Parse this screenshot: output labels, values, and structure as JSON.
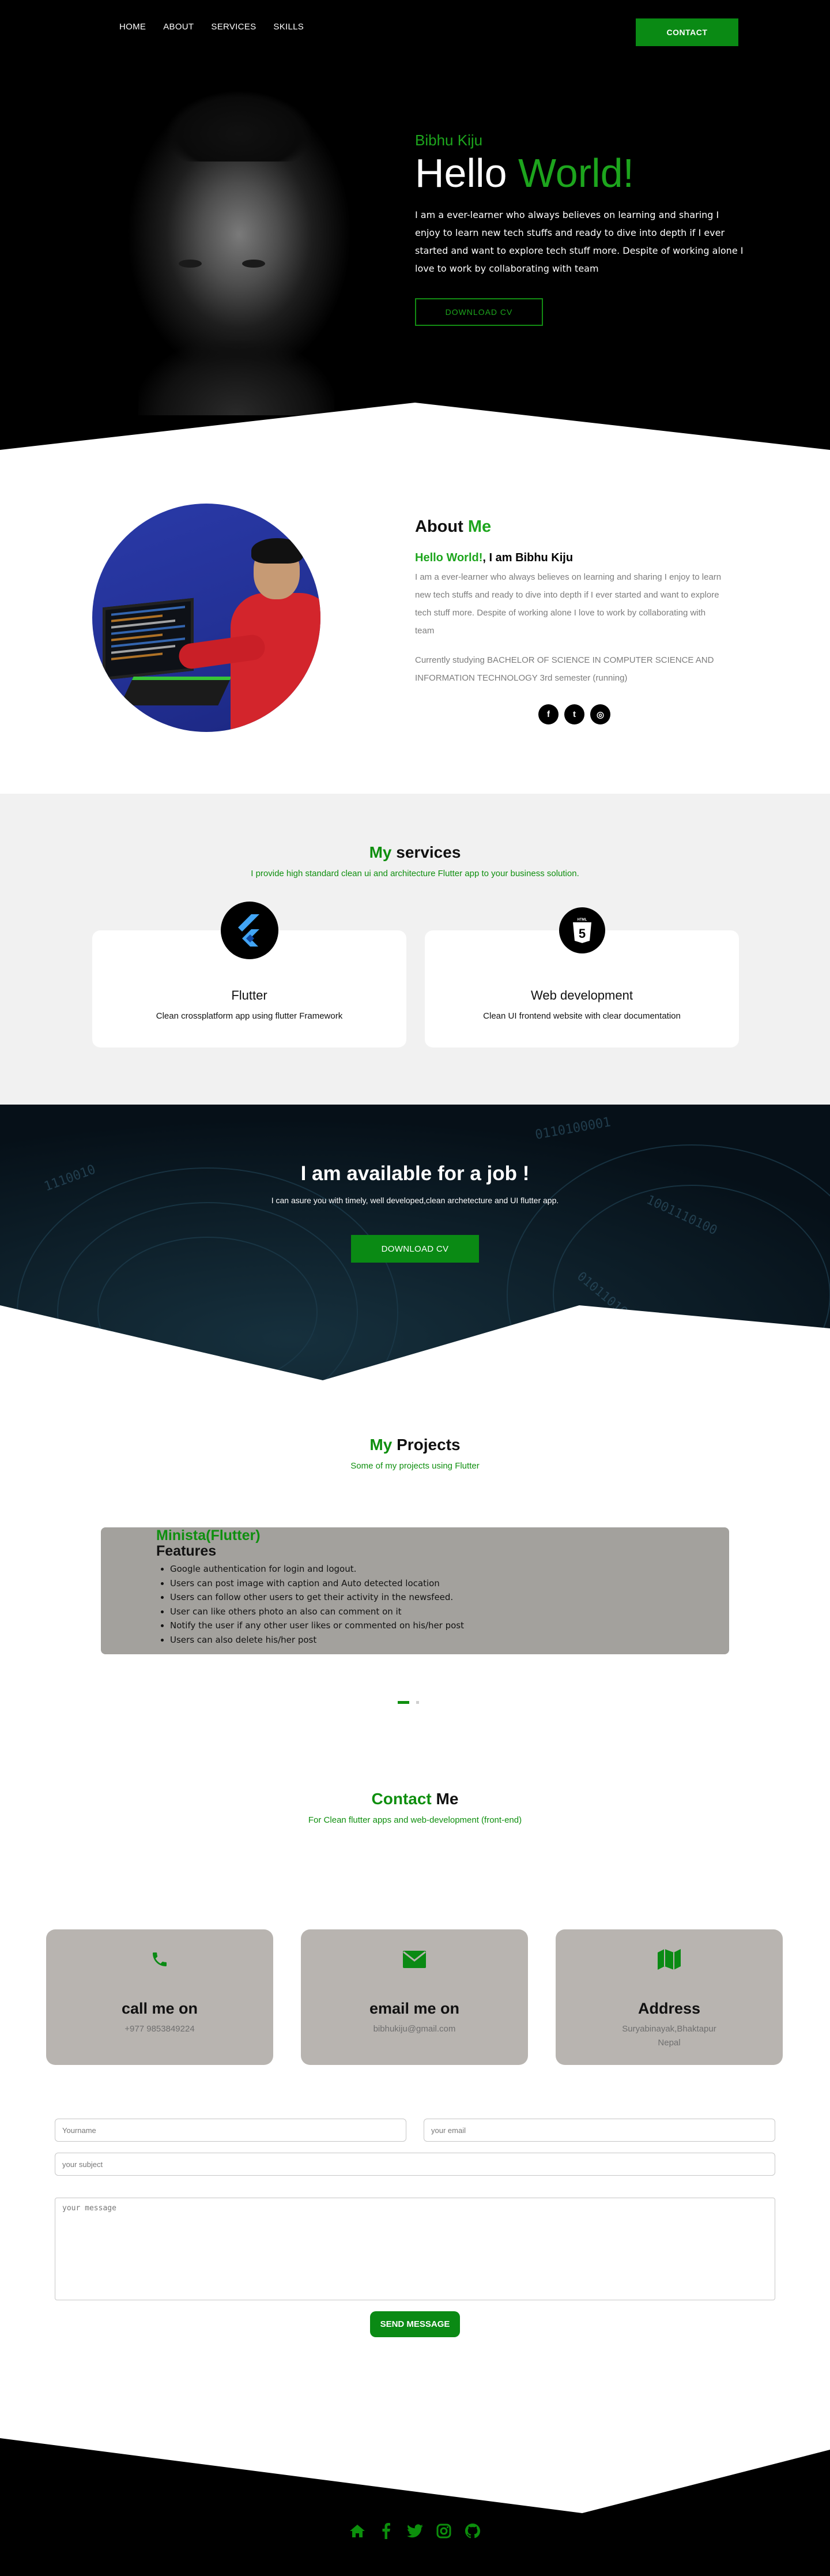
{
  "nav": {
    "items": [
      "HOME",
      "ABOUT",
      "SERVICES",
      "SKILLS"
    ],
    "contact_label": "CONTACT"
  },
  "hero": {
    "name": "Bibhu Kiju",
    "title_white": "Hello ",
    "title_green": "World!",
    "description": "I am a ever-learner who always believes on learning and sharing I enjoy to learn new tech stuffs and ready to dive into depth if I ever started and want to explore tech stuff more. Despite of working alone I love to work by collaborating with team",
    "cv_label": "DOWNLOAD CV"
  },
  "about": {
    "heading_plain": "About ",
    "heading_green": "Me",
    "hello_green": "Hello World!",
    "hello_rest": ", I am Bibhu Kiju",
    "description": "I am a ever-learner who always believes on learning and sharing I enjoy to learn new tech stuffs and ready to dive into depth if I ever started and want to explore tech stuff more. Despite of working alone I love to work by collaborating with team",
    "study": "Currently studying BACHELOR OF SCIENCE IN COMPUTER SCIENCE AND INFORMATION TECHNOLOGY 3rd semester (running)",
    "socials": [
      "f",
      "t",
      "◎"
    ]
  },
  "services": {
    "title_green": "My",
    "title_plain": " services",
    "subtitle": "I provide high standard clean ui and architecture Flutter app to your business solution.",
    "cards": [
      {
        "title": "Flutter",
        "desc": "Clean crossplatform app using flutter Framework",
        "icon": "flutter-icon"
      },
      {
        "title": "Web development",
        "desc": "Clean UI frontend website with clear documentation",
        "icon": "html5-icon"
      }
    ]
  },
  "job": {
    "title": "I am available for a job !",
    "subtitle": "I can asure you with timely, well developed,clean archetecture and UI flutter app.",
    "cv_label": "DOWNLOAD CV"
  },
  "projects": {
    "title_green": "My",
    "title_plain": " Projects",
    "subtitle": "Some of my projects using Flutter",
    "project": {
      "name": "Minista(Flutter)",
      "features_label": "Features",
      "features": [
        "Google authentication for login and logout.",
        "Users can post image with caption and Auto detected location",
        "Users can follow other users to get their activity in the newsfeed.",
        "User can like others photo an also can comment on it",
        "Notify the user if any other user likes or commented on his/her post",
        "Users can also delete his/her post"
      ]
    }
  },
  "contact": {
    "title_green": "Contact",
    "title_plain": " Me",
    "subtitle": "For Clean flutter apps and web-development (front-end)",
    "cards": [
      {
        "title": "call me on",
        "value": "+977 9853849224",
        "icon": "phone-icon"
      },
      {
        "title": "email me on",
        "value": "bibhukiju@gmail.com",
        "icon": "envelope-icon"
      },
      {
        "title": "Address",
        "value": "Suryabinayak,Bhaktapur Nepal",
        "icon": "map-icon"
      }
    ],
    "form": {
      "name_placeholder": "Yourname",
      "email_placeholder": "your email",
      "subject_placeholder": "your subject",
      "message_placeholder": "your message",
      "send_label": "SEND MESSAGE"
    }
  },
  "footer": {
    "icons": [
      "home-icon",
      "facebook-icon",
      "twitter-icon",
      "instagram-icon",
      "github-icon"
    ]
  },
  "colors": {
    "accent": "#0a8a14",
    "accent_text": "#1da51d",
    "card_grey": "#b8b4b0",
    "project_grey": "#a3a19d"
  }
}
